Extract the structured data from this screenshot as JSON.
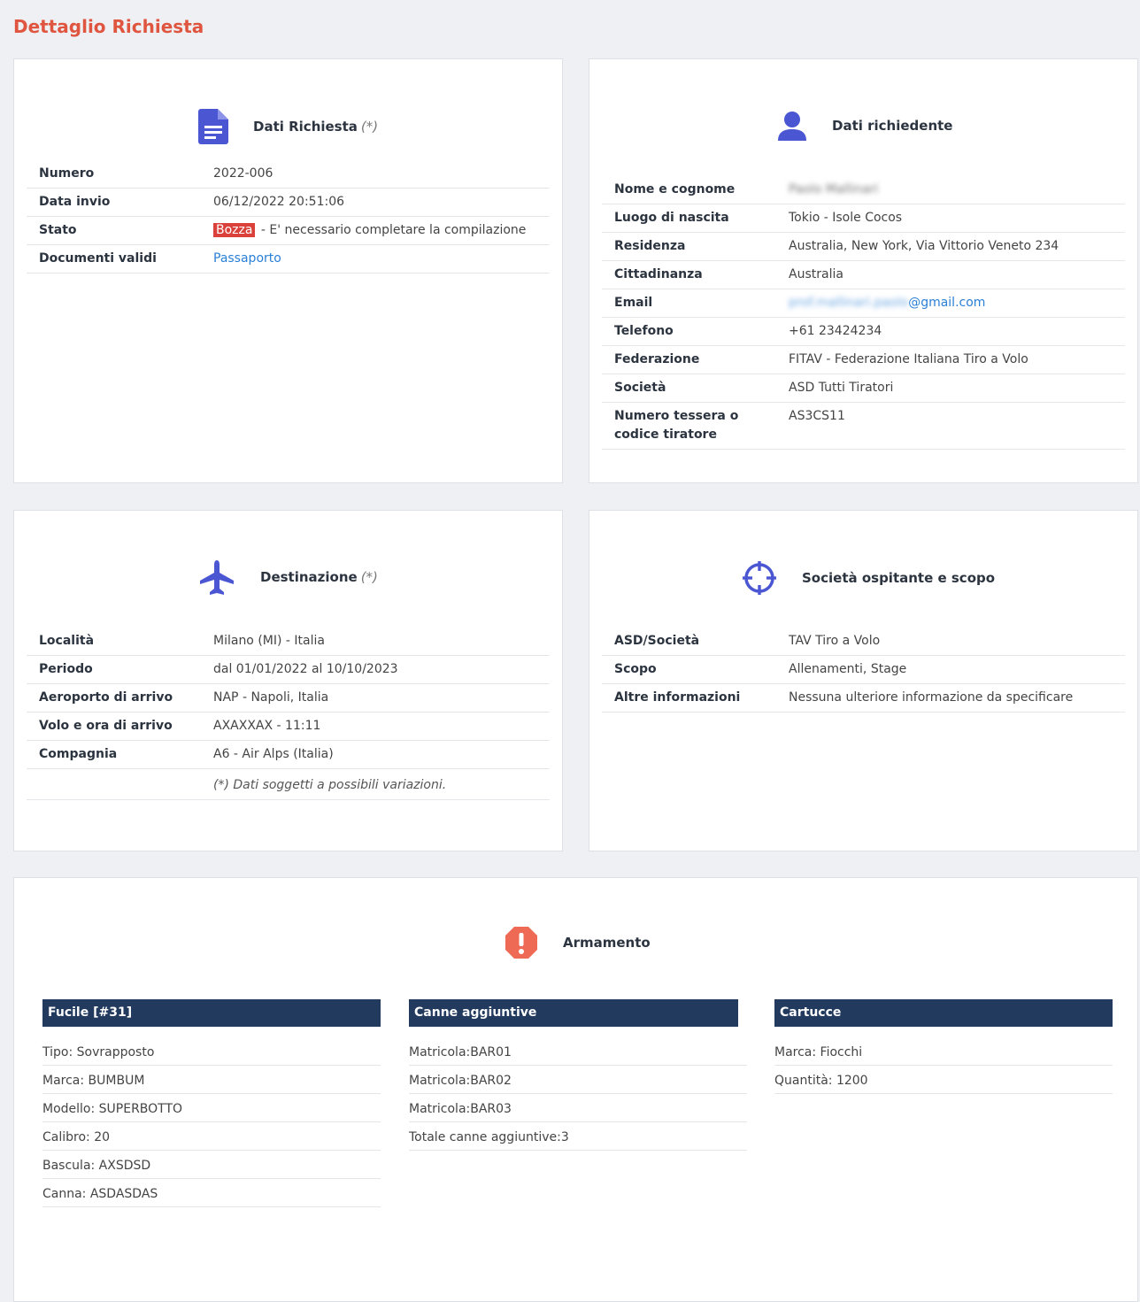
{
  "page_title": "Dettaglio Richiesta",
  "dati_richiesta": {
    "title": "Dati Richiesta",
    "note": "(*)",
    "rows": {
      "numero": {
        "label": "Numero",
        "value": "2022-006"
      },
      "data_invio": {
        "label": "Data invio",
        "value": "06/12/2022 20:51:06"
      },
      "stato": {
        "label": "Stato",
        "badge": "Bozza",
        "value": "- E' necessario completare la compilazione"
      },
      "documenti": {
        "label": "Documenti validi",
        "value": "Passaporto"
      }
    }
  },
  "dati_richiedente": {
    "title": "Dati richiedente",
    "rows": {
      "nome": {
        "label": "Nome e cognome",
        "value": "Paolo Mallinari"
      },
      "luogo": {
        "label": "Luogo di nascita",
        "value": "Tokio - Isole Cocos"
      },
      "residenza": {
        "label": "Residenza",
        "value": "Australia, New York, Via Vittorio Veneto 234"
      },
      "cittadinanza": {
        "label": "Cittadinanza",
        "value": "Australia"
      },
      "email": {
        "label": "Email",
        "value_hidden": "prof.mallinari.paolo",
        "value_visible": "@gmail.com"
      },
      "telefono": {
        "label": "Telefono",
        "value": "+61 23424234"
      },
      "federazione": {
        "label": "Federazione",
        "value": "FITAV - Federazione Italiana Tiro a Volo"
      },
      "societa": {
        "label": "Società",
        "value": "ASD Tutti Tiratori"
      },
      "tessera": {
        "label": "Numero tessera o codice tiratore",
        "value": "AS3CS11"
      }
    }
  },
  "destinazione": {
    "title": "Destinazione",
    "note": "(*)",
    "rows": {
      "localita": {
        "label": "Località",
        "value": "Milano (MI) - Italia"
      },
      "periodo": {
        "label": "Periodo",
        "value": "dal 01/01/2022 al 10/10/2023"
      },
      "aeroporto": {
        "label": "Aeroporto di arrivo",
        "value": "NAP - Napoli, Italia"
      },
      "volo": {
        "label": "Volo e ora di arrivo",
        "value": "AXAXXAX - 11:11"
      },
      "compagnia": {
        "label": "Compagnia",
        "value": "A6 - Air Alps (Italia)"
      }
    },
    "footnote": "(*) Dati soggetti a possibili variazioni."
  },
  "societa_ospitante": {
    "title": "Società ospitante e scopo",
    "rows": {
      "asd": {
        "label": "ASD/Società",
        "value": "TAV Tiro a Volo"
      },
      "scopo": {
        "label": "Scopo",
        "value": "Allenamenti, Stage"
      },
      "altre": {
        "label": "Altre informazioni",
        "value": "Nessuna ulteriore informazione da specificare"
      }
    }
  },
  "armamento": {
    "title": "Armamento",
    "fucile": {
      "title": "Fucile [#31]",
      "items": [
        "Tipo: Sovrapposto",
        "Marca: BUMBUM",
        "Modello: SUPERBOTTO",
        "Calibro: 20",
        "Bascula: AXSDSD",
        "Canna: ASDASDAS"
      ]
    },
    "canne": {
      "title": "Canne aggiuntive",
      "items": [
        "Matricola:BAR01",
        "Matricola:BAR02",
        "Matricola:BAR03",
        "Totale canne aggiuntive:3"
      ]
    },
    "cartucce": {
      "title": "Cartucce",
      "items": [
        "Marca: Fiocchi",
        "Quantità: 1200"
      ]
    }
  },
  "colors": {
    "accent_title": "#e05540",
    "icon_blue": "#4b56d2",
    "header_navy": "#223a5e",
    "alert_red": "#ef6a55"
  },
  "icons": [
    "document-icon",
    "user-icon",
    "airplane-icon",
    "crosshair-icon",
    "alert-icon"
  ]
}
